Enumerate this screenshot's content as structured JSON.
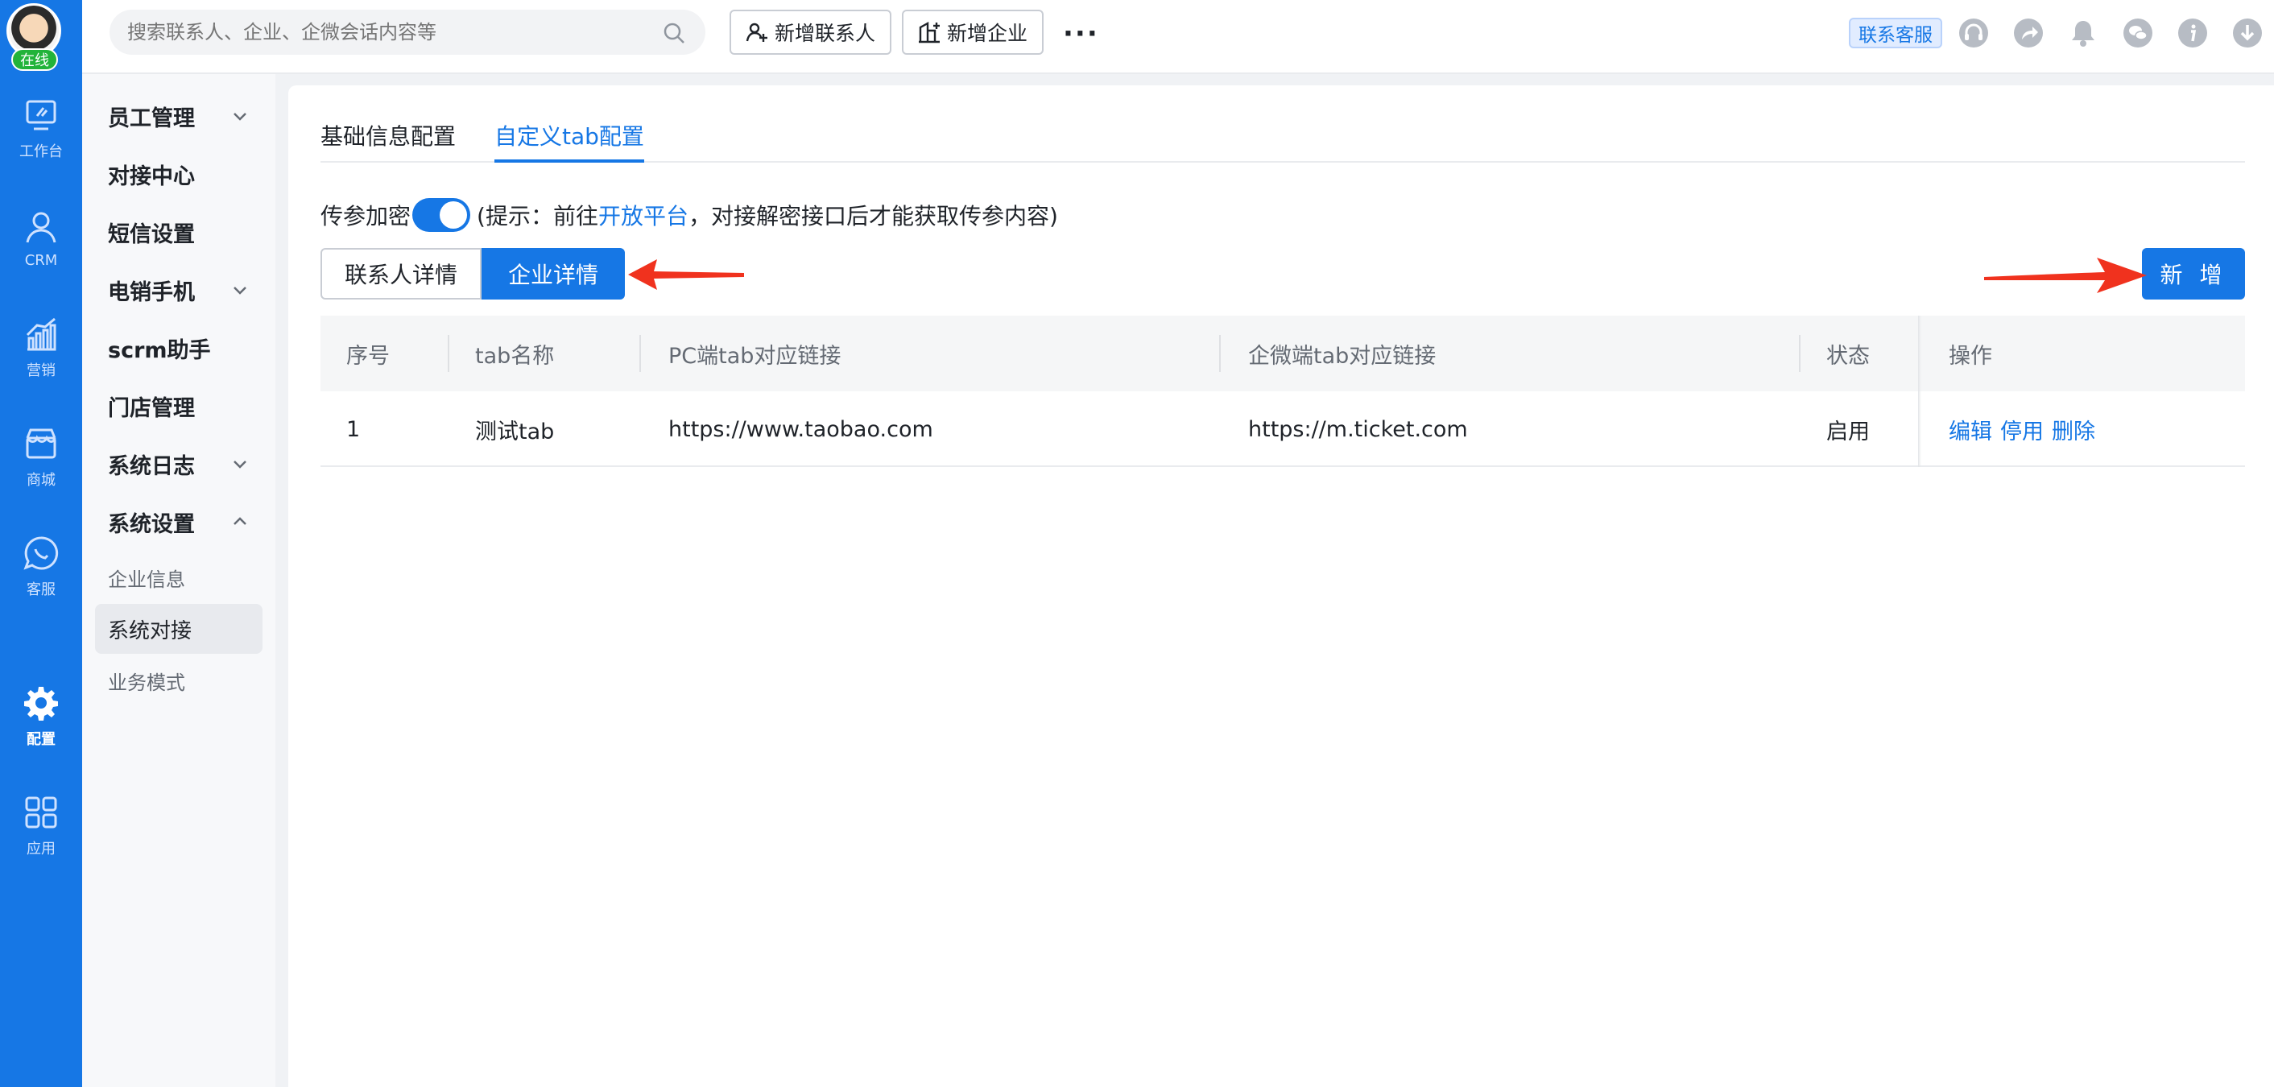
{
  "user": {
    "status": "在线"
  },
  "rail": [
    {
      "label": "工作台",
      "icon": "workbench-icon"
    },
    {
      "label": "CRM",
      "icon": "person-icon"
    },
    {
      "label": "营销",
      "icon": "chart-icon"
    },
    {
      "label": "商城",
      "icon": "store-icon"
    },
    {
      "label": "客服",
      "icon": "chat-icon"
    },
    {
      "label": "配置",
      "icon": "gear-icon",
      "active": true
    },
    {
      "label": "应用",
      "icon": "grid-icon"
    }
  ],
  "sidebar": {
    "items": [
      {
        "label": "员工管理",
        "expandable": true
      },
      {
        "label": "对接中心"
      },
      {
        "label": "短信设置"
      },
      {
        "label": "电销手机",
        "expandable": true
      },
      {
        "label": "scrm助手"
      },
      {
        "label": "门店管理"
      },
      {
        "label": "系统日志",
        "expandable": true
      },
      {
        "label": "系统设置",
        "expanded": true
      }
    ],
    "sub_items": [
      {
        "label": "企业信息"
      },
      {
        "label": "系统对接",
        "active": true
      },
      {
        "label": "业务模式"
      }
    ]
  },
  "topbar": {
    "search_placeholder": "搜索联系人、企业、企微会话内容等",
    "add_contact": "新增联系人",
    "add_company": "新增企业",
    "more": "···",
    "contact_service": "联系客服"
  },
  "tabs": [
    {
      "label": "基础信息配置"
    },
    {
      "label": "自定义tab配置",
      "active": true
    }
  ],
  "encryption": {
    "label": "传参加密",
    "enabled": true,
    "hint_prefix": "(提示：前往 ",
    "hint_link": "开放平台",
    "hint_suffix": "，对接解密接口后才能获取传参内容)"
  },
  "segments": {
    "contact": "联系人详情",
    "company": "企业详情",
    "selected": "企业详情"
  },
  "add_button": "新 增",
  "table": {
    "columns": [
      "序号",
      "tab名称",
      "PC端tab对应链接",
      "企微端tab对应链接",
      "状态",
      "操作"
    ],
    "rows": [
      {
        "index": "1",
        "name": "测试tab",
        "pc_link": "https://www.taobao.com",
        "wecom_link": "https://m.ticket.com",
        "status": "启用",
        "actions": [
          "编辑",
          "停用",
          "删除"
        ]
      }
    ]
  },
  "colors": {
    "primary": "#1677e5",
    "online": "#22b33a",
    "annotation_arrow": "#f0321e"
  }
}
